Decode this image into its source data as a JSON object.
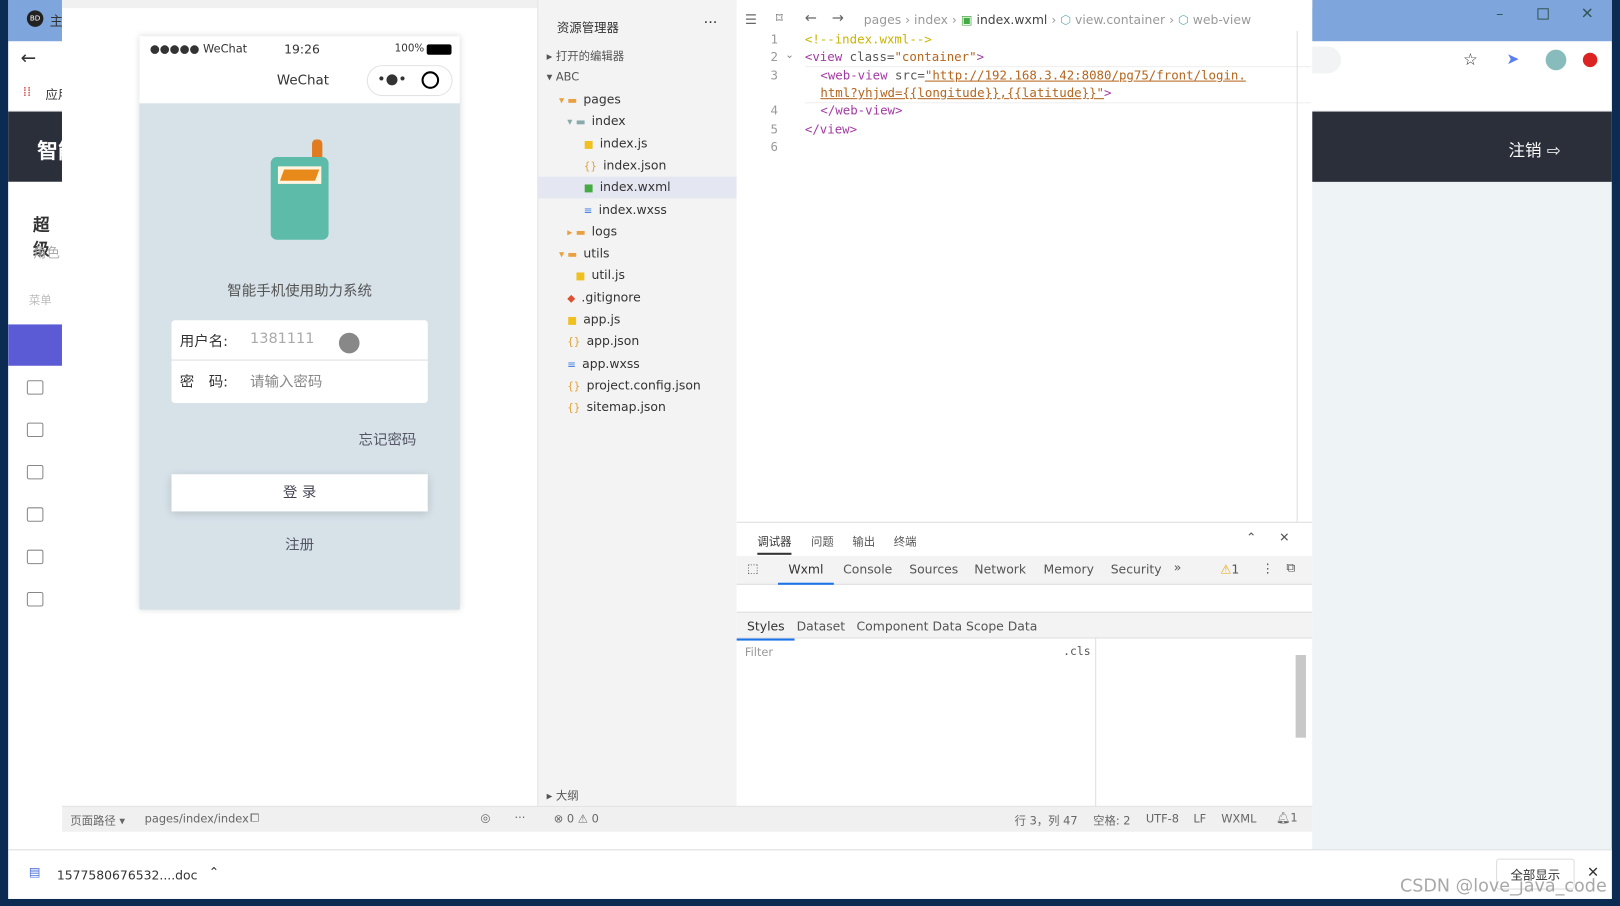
{
  "browser": {
    "tab_title": "主",
    "tab_icon": "BD",
    "bookmarks_apps": "应用",
    "page_header_title": "智能",
    "logout": "注销",
    "user_name": "超级",
    "user_role": "角色",
    "menu_label": "菜单",
    "accent": "#5b5bd6"
  },
  "simulator": {
    "carrier": "●●●●● WeChat",
    "time": "19:26",
    "battery": "100%",
    "nav_title": "WeChat",
    "app_title": "智能手机使用助力系统",
    "username_label": "用户名:",
    "username_value": "1381111",
    "password_label": "密　码:",
    "password_placeholder": "请输入密码",
    "forgot": "忘记密码",
    "login": "登 录",
    "register": "注册"
  },
  "explorer": {
    "title": "资源管理器",
    "open_editors": "打开的编辑器",
    "project": "ABC",
    "outline": "大纲",
    "items": [
      {
        "label": "pages",
        "icon": "folder-icon",
        "depth": 1
      },
      {
        "label": "index",
        "icon": "folder-open-icon",
        "depth": 2
      },
      {
        "label": "index.js",
        "icon": "js-file-icon",
        "depth": 3
      },
      {
        "label": "index.json",
        "icon": "json-file-icon",
        "depth": 3
      },
      {
        "label": "index.wxml",
        "icon": "wxml-file-icon",
        "depth": 3,
        "selected": true
      },
      {
        "label": "index.wxss",
        "icon": "wxss-file-icon",
        "depth": 3
      },
      {
        "label": "logs",
        "icon": "folder-icon",
        "depth": 2
      },
      {
        "label": "utils",
        "icon": "folder-icon",
        "depth": 1
      },
      {
        "label": "util.js",
        "icon": "js-file-icon",
        "depth": 2
      },
      {
        "label": ".gitignore",
        "icon": "git-icon",
        "depth": 1
      },
      {
        "label": "app.js",
        "icon": "js-file-icon",
        "depth": 1
      },
      {
        "label": "app.json",
        "icon": "json-file-icon",
        "depth": 1
      },
      {
        "label": "app.wxss",
        "icon": "wxss-file-icon",
        "depth": 1
      },
      {
        "label": "project.config.json",
        "icon": "json-file-icon",
        "depth": 1
      },
      {
        "label": "sitemap.json",
        "icon": "json-file-icon",
        "depth": 1
      }
    ]
  },
  "editor": {
    "breadcrumb": [
      "pages",
      "index",
      "index.wxml",
      "view.container",
      "web-view"
    ],
    "lines": [
      "1",
      "2",
      "3",
      "",
      "4",
      "5",
      "6"
    ],
    "code": {
      "l1": "<!--index.wxml-->",
      "l2a": "<view",
      "l2b": " class=",
      "l2c": "\"container\"",
      "l2d": ">",
      "l3a": "<web-view",
      "l3b": " src=",
      "l3c": "\"http://192.168.3.42:8080/pg75/front/login.",
      "l3d": "html?yhjwd={{longitude}},{{latitude}}\"",
      "l3e": ">",
      "l4": "</web-view>",
      "l5": "</view>"
    }
  },
  "debugger": {
    "tabs": [
      "调试器",
      "问题",
      "输出",
      "终端"
    ],
    "devtabs": [
      "Wxml",
      "Console",
      "Sources",
      "Network",
      "Memory",
      "Security"
    ],
    "more": "»",
    "warnings": "1",
    "subtabs": [
      "Styles",
      "Dataset",
      "Component Data",
      "Scope Data"
    ],
    "filter_placeholder": "Filter",
    "cls": ".cls"
  },
  "statusbar": {
    "page_path_label": "页面路径 ▾",
    "page_path": "pages/index/index",
    "errors": "0",
    "warns": "0",
    "position": "行 3，列 47",
    "spaces": "空格: 2",
    "encoding": "UTF-8",
    "eol": "LF",
    "lang": "WXML",
    "notifications": "1"
  },
  "download": {
    "file": "1577580676532....doc",
    "show_all": "全部显示"
  },
  "watermark": "CSDN @love_java_code"
}
